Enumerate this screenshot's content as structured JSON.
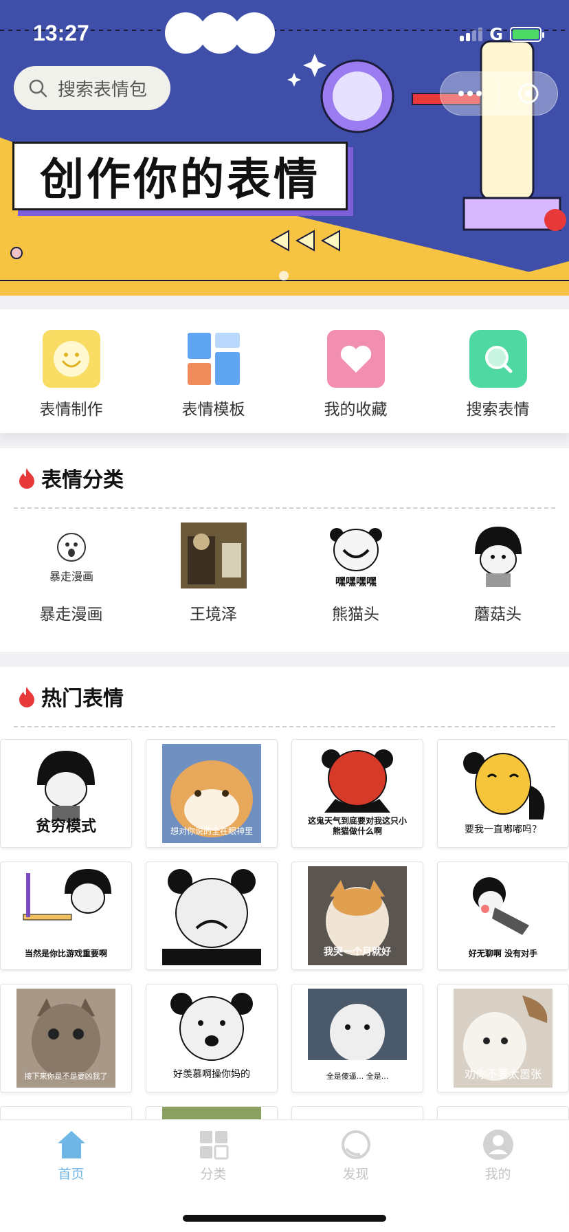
{
  "status_bar": {
    "time": "13:27",
    "network": "G"
  },
  "search": {
    "placeholder": "搜索表情包"
  },
  "banner": {
    "headline": "创作你的表情"
  },
  "quick_nav": [
    {
      "label": "表情制作",
      "icon": "smile-face-icon",
      "color": "#f9dc63"
    },
    {
      "label": "表情模板",
      "icon": "template-grid-icon",
      "color": "#60a5f2"
    },
    {
      "label": "我的收藏",
      "icon": "heart-icon",
      "color": "#f28fb0"
    },
    {
      "label": "搜索表情",
      "icon": "search-icon",
      "color": "#4fd8a1"
    }
  ],
  "category_section": {
    "title": "表情分类",
    "items": [
      {
        "label": "暴走漫画",
        "thumb_text": "暴走漫画"
      },
      {
        "label": "王境泽",
        "thumb_text": ""
      },
      {
        "label": "熊猫头",
        "thumb_text": "嘿嘿嘿嘿"
      },
      {
        "label": "蘑菇头",
        "thumb_text": ""
      }
    ]
  },
  "hot_section": {
    "title": "热门表情",
    "rows": [
      [
        {
          "caption": "贫穷模式"
        },
        {
          "caption": "想对你说的全在眼神里"
        },
        {
          "caption": "这鬼天气到底要对我这只小熊猫做什么啊"
        },
        {
          "caption": "要我一直嘟嘟吗？"
        }
      ],
      [
        {
          "caption": "当然是你比游戏重要啊"
        },
        {
          "caption": ""
        },
        {
          "caption": "我哭一个月就好"
        },
        {
          "caption": "好无聊啊 没有对手"
        }
      ],
      [
        {
          "caption": "接下来你是不是要凶我了"
        },
        {
          "caption": "好羡慕啊操你妈的"
        },
        {
          "caption": "全是傻逼... 全是..."
        },
        {
          "caption": "劝你不要太嚣张"
        }
      ]
    ]
  },
  "tabbar": [
    {
      "label": "首页",
      "icon": "home-icon",
      "active": true
    },
    {
      "label": "分类",
      "icon": "category-icon",
      "active": false
    },
    {
      "label": "发现",
      "icon": "discover-icon",
      "active": false
    },
    {
      "label": "我的",
      "icon": "profile-icon",
      "active": false
    }
  ],
  "colors": {
    "banner_blue": "#3f4fa9",
    "banner_yellow": "#f6c343",
    "accent_red": "#e8393a",
    "tab_active": "#6fb6e6"
  }
}
